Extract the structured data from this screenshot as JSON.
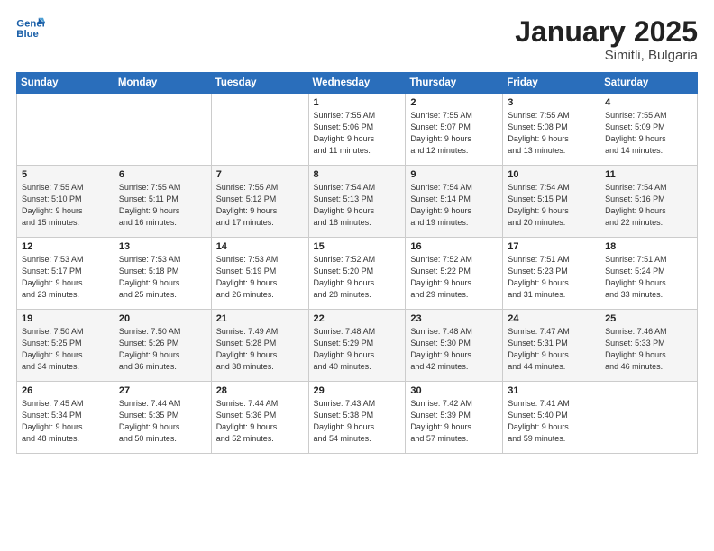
{
  "header": {
    "logo_line1": "General",
    "logo_line2": "Blue",
    "title": "January 2025",
    "subtitle": "Simitli, Bulgaria"
  },
  "weekdays": [
    "Sunday",
    "Monday",
    "Tuesday",
    "Wednesday",
    "Thursday",
    "Friday",
    "Saturday"
  ],
  "weeks": [
    [
      {
        "day": "",
        "info": ""
      },
      {
        "day": "",
        "info": ""
      },
      {
        "day": "",
        "info": ""
      },
      {
        "day": "1",
        "info": "Sunrise: 7:55 AM\nSunset: 5:06 PM\nDaylight: 9 hours\nand 11 minutes."
      },
      {
        "day": "2",
        "info": "Sunrise: 7:55 AM\nSunset: 5:07 PM\nDaylight: 9 hours\nand 12 minutes."
      },
      {
        "day": "3",
        "info": "Sunrise: 7:55 AM\nSunset: 5:08 PM\nDaylight: 9 hours\nand 13 minutes."
      },
      {
        "day": "4",
        "info": "Sunrise: 7:55 AM\nSunset: 5:09 PM\nDaylight: 9 hours\nand 14 minutes."
      }
    ],
    [
      {
        "day": "5",
        "info": "Sunrise: 7:55 AM\nSunset: 5:10 PM\nDaylight: 9 hours\nand 15 minutes."
      },
      {
        "day": "6",
        "info": "Sunrise: 7:55 AM\nSunset: 5:11 PM\nDaylight: 9 hours\nand 16 minutes."
      },
      {
        "day": "7",
        "info": "Sunrise: 7:55 AM\nSunset: 5:12 PM\nDaylight: 9 hours\nand 17 minutes."
      },
      {
        "day": "8",
        "info": "Sunrise: 7:54 AM\nSunset: 5:13 PM\nDaylight: 9 hours\nand 18 minutes."
      },
      {
        "day": "9",
        "info": "Sunrise: 7:54 AM\nSunset: 5:14 PM\nDaylight: 9 hours\nand 19 minutes."
      },
      {
        "day": "10",
        "info": "Sunrise: 7:54 AM\nSunset: 5:15 PM\nDaylight: 9 hours\nand 20 minutes."
      },
      {
        "day": "11",
        "info": "Sunrise: 7:54 AM\nSunset: 5:16 PM\nDaylight: 9 hours\nand 22 minutes."
      }
    ],
    [
      {
        "day": "12",
        "info": "Sunrise: 7:53 AM\nSunset: 5:17 PM\nDaylight: 9 hours\nand 23 minutes."
      },
      {
        "day": "13",
        "info": "Sunrise: 7:53 AM\nSunset: 5:18 PM\nDaylight: 9 hours\nand 25 minutes."
      },
      {
        "day": "14",
        "info": "Sunrise: 7:53 AM\nSunset: 5:19 PM\nDaylight: 9 hours\nand 26 minutes."
      },
      {
        "day": "15",
        "info": "Sunrise: 7:52 AM\nSunset: 5:20 PM\nDaylight: 9 hours\nand 28 minutes."
      },
      {
        "day": "16",
        "info": "Sunrise: 7:52 AM\nSunset: 5:22 PM\nDaylight: 9 hours\nand 29 minutes."
      },
      {
        "day": "17",
        "info": "Sunrise: 7:51 AM\nSunset: 5:23 PM\nDaylight: 9 hours\nand 31 minutes."
      },
      {
        "day": "18",
        "info": "Sunrise: 7:51 AM\nSunset: 5:24 PM\nDaylight: 9 hours\nand 33 minutes."
      }
    ],
    [
      {
        "day": "19",
        "info": "Sunrise: 7:50 AM\nSunset: 5:25 PM\nDaylight: 9 hours\nand 34 minutes."
      },
      {
        "day": "20",
        "info": "Sunrise: 7:50 AM\nSunset: 5:26 PM\nDaylight: 9 hours\nand 36 minutes."
      },
      {
        "day": "21",
        "info": "Sunrise: 7:49 AM\nSunset: 5:28 PM\nDaylight: 9 hours\nand 38 minutes."
      },
      {
        "day": "22",
        "info": "Sunrise: 7:48 AM\nSunset: 5:29 PM\nDaylight: 9 hours\nand 40 minutes."
      },
      {
        "day": "23",
        "info": "Sunrise: 7:48 AM\nSunset: 5:30 PM\nDaylight: 9 hours\nand 42 minutes."
      },
      {
        "day": "24",
        "info": "Sunrise: 7:47 AM\nSunset: 5:31 PM\nDaylight: 9 hours\nand 44 minutes."
      },
      {
        "day": "25",
        "info": "Sunrise: 7:46 AM\nSunset: 5:33 PM\nDaylight: 9 hours\nand 46 minutes."
      }
    ],
    [
      {
        "day": "26",
        "info": "Sunrise: 7:45 AM\nSunset: 5:34 PM\nDaylight: 9 hours\nand 48 minutes."
      },
      {
        "day": "27",
        "info": "Sunrise: 7:44 AM\nSunset: 5:35 PM\nDaylight: 9 hours\nand 50 minutes."
      },
      {
        "day": "28",
        "info": "Sunrise: 7:44 AM\nSunset: 5:36 PM\nDaylight: 9 hours\nand 52 minutes."
      },
      {
        "day": "29",
        "info": "Sunrise: 7:43 AM\nSunset: 5:38 PM\nDaylight: 9 hours\nand 54 minutes."
      },
      {
        "day": "30",
        "info": "Sunrise: 7:42 AM\nSunset: 5:39 PM\nDaylight: 9 hours\nand 57 minutes."
      },
      {
        "day": "31",
        "info": "Sunrise: 7:41 AM\nSunset: 5:40 PM\nDaylight: 9 hours\nand 59 minutes."
      },
      {
        "day": "",
        "info": ""
      }
    ]
  ]
}
